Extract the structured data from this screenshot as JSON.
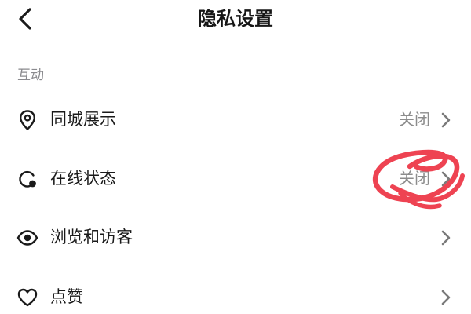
{
  "header": {
    "title": "隐私设置",
    "back_icon": "chevron-left-icon"
  },
  "section": {
    "title": "互动"
  },
  "rows": [
    {
      "label": "同城展示",
      "value": "关闭",
      "icon": "location-pin-icon"
    },
    {
      "label": "在线状态",
      "value": "关闭",
      "icon": "online-status-icon"
    },
    {
      "label": "浏览和访客",
      "value": "",
      "icon": "eye-icon"
    },
    {
      "label": "点赞",
      "value": "",
      "icon": "heart-icon"
    }
  ],
  "colors": {
    "annotation": "#ee4352",
    "secondary_text": "#8c8c8c",
    "chevron": "#7a7a7a"
  }
}
